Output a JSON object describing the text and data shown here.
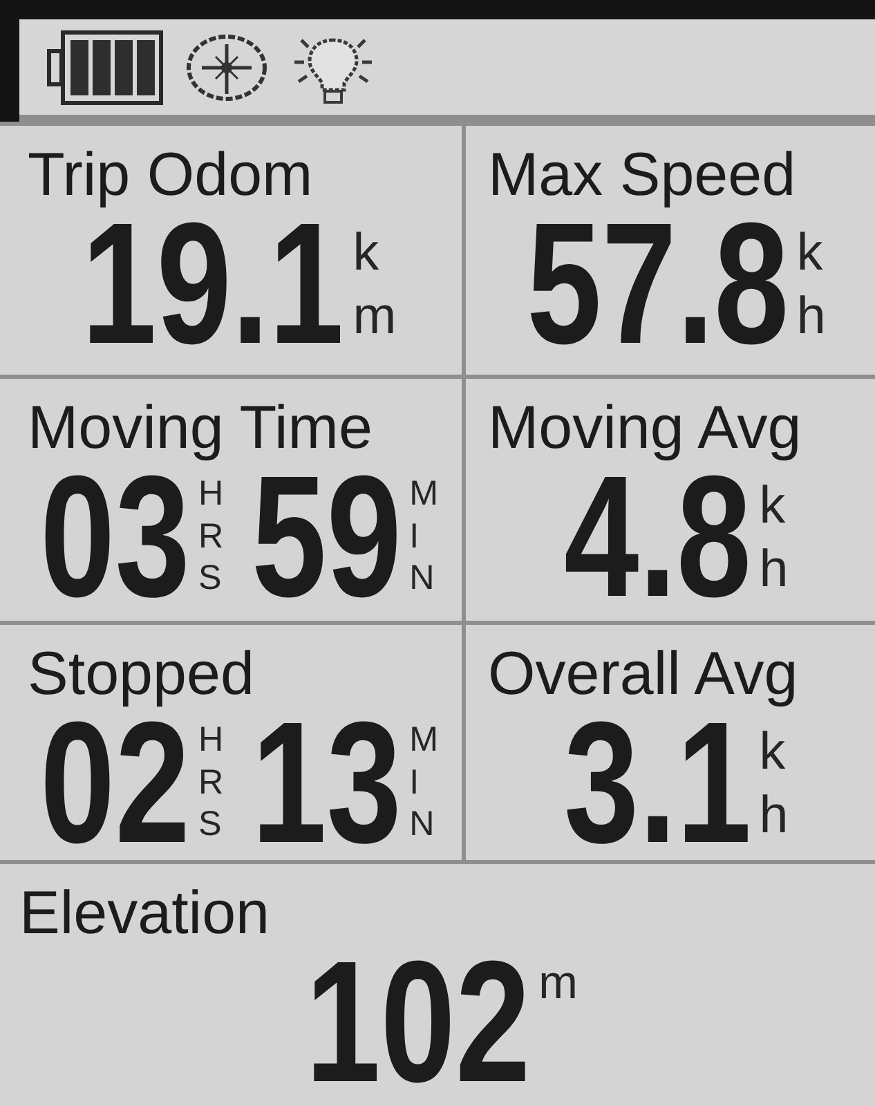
{
  "fields": [
    {
      "label": "Trip Odom",
      "parts": [
        {
          "value": "19.1",
          "unit": "km"
        }
      ]
    },
    {
      "label": "Max Speed",
      "parts": [
        {
          "value": "57.8",
          "unit": "kh"
        }
      ]
    },
    {
      "label": "Moving Time",
      "parts": [
        {
          "value": "03",
          "unit": "HRS"
        },
        {
          "value": "59",
          "unit": "MIN"
        }
      ]
    },
    {
      "label": "Moving Avg",
      "parts": [
        {
          "value": "4.8",
          "unit": "kh"
        }
      ]
    },
    {
      "label": "Stopped",
      "parts": [
        {
          "value": "02",
          "unit": "HRS"
        },
        {
          "value": "13",
          "unit": "MIN"
        }
      ]
    },
    {
      "label": "Overall Avg",
      "parts": [
        {
          "value": "3.1",
          "unit": "kh"
        }
      ]
    }
  ],
  "wide_field": {
    "label": "Elevation",
    "parts": [
      {
        "value": "102",
        "unit": "m"
      }
    ]
  }
}
